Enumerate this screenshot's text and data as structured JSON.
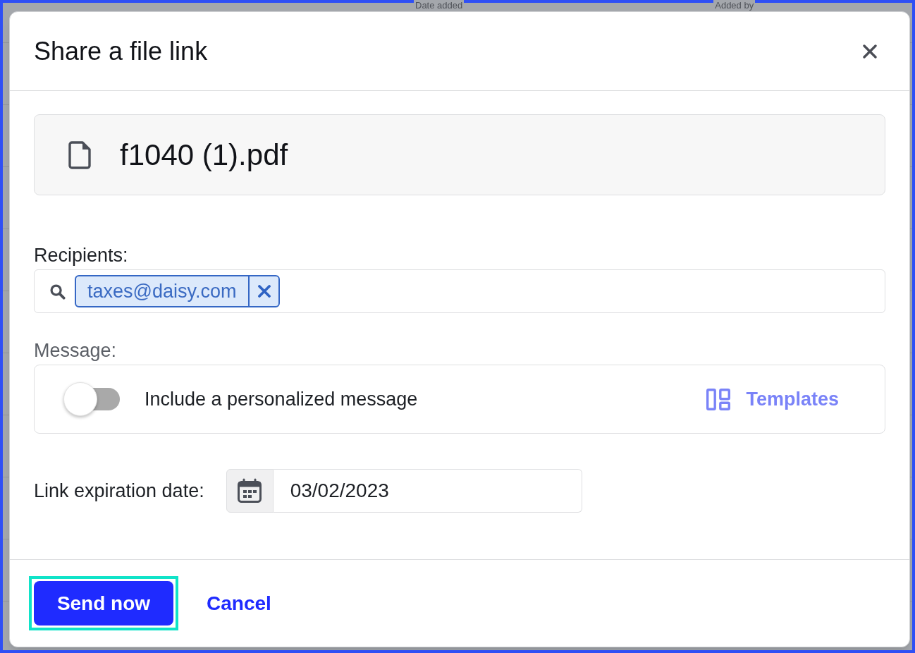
{
  "background_page": {
    "column_headers": [
      "Date added",
      "Added by"
    ]
  },
  "dialog": {
    "title": "Share a file link"
  },
  "file": {
    "name": "f1040 (1).pdf"
  },
  "recipients": {
    "label": "Recipients:",
    "chips": [
      {
        "text": "taxes@daisy.com"
      }
    ]
  },
  "message": {
    "label": "Message:",
    "toggle": {
      "on": false,
      "label": "Include a personalized message"
    },
    "templates_link": "Templates"
  },
  "expiration": {
    "label": "Link expiration date:",
    "value": "03/02/2023"
  },
  "buttons": [
    {
      "label": "Send now",
      "kind": "primary",
      "focused": true
    },
    {
      "label": "Cancel",
      "kind": "link",
      "focused": false
    }
  ]
}
